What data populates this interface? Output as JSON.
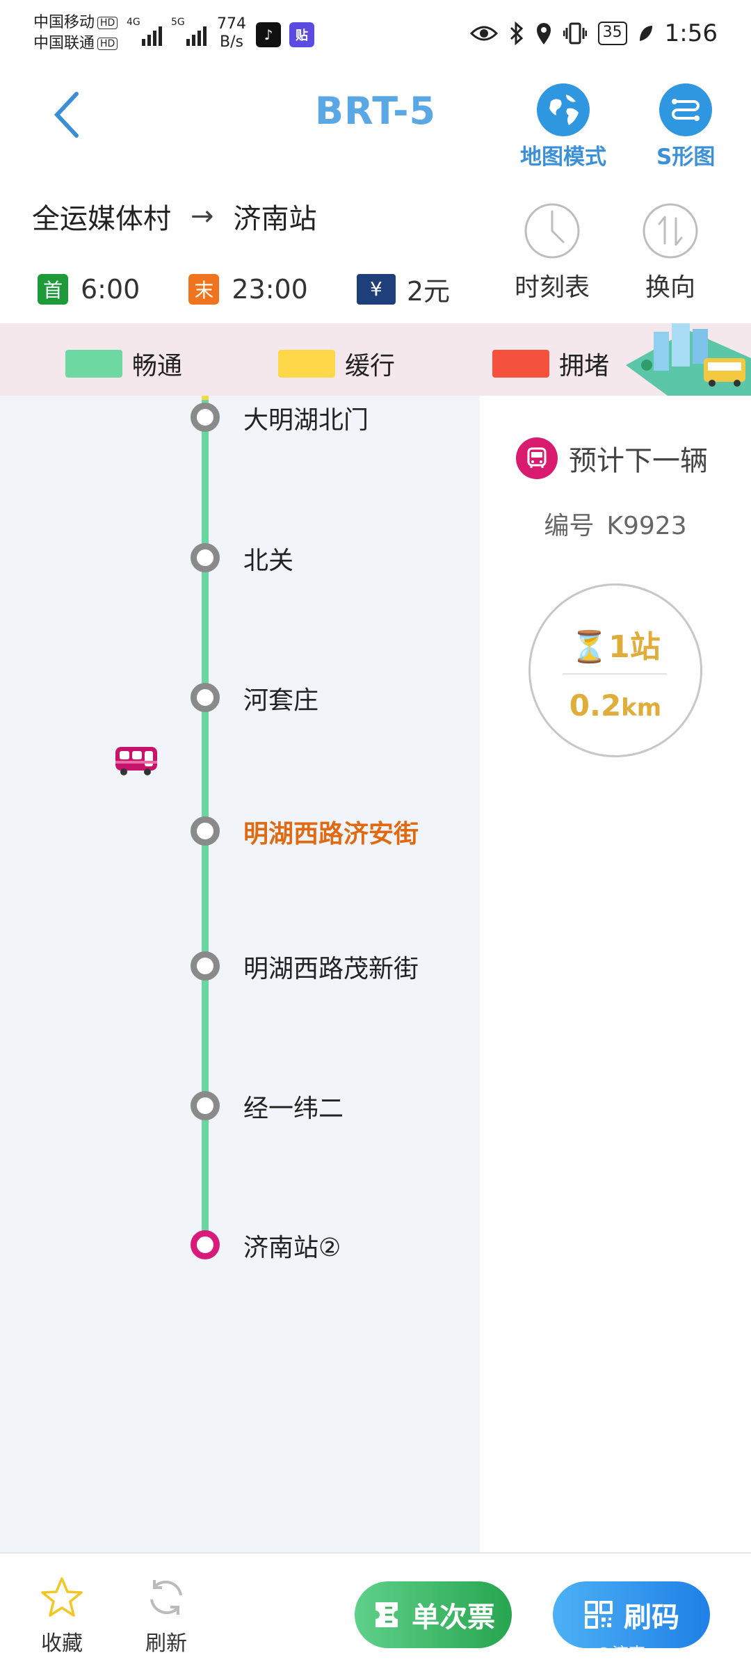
{
  "status_bar": {
    "carrier1": "中国移动",
    "carrier2": "中国联通",
    "hd": "HD",
    "net1": "4G",
    "net2": "5G",
    "speed_value": "774",
    "speed_unit": "B/s",
    "app_badge": "贴",
    "battery": "35",
    "time": "1:56"
  },
  "header": {
    "title": "BRT-5",
    "map_mode_label": "地图模式",
    "s_map_label": "S形图"
  },
  "route": {
    "from": "全运媒体村",
    "arrow": "→",
    "to": "济南站",
    "first_tag": "首",
    "first_time": "6:00",
    "last_tag": "末",
    "last_time": "23:00",
    "fare_tag": "¥",
    "fare": "2元",
    "timetable_label": "时刻表",
    "reverse_label": "换向",
    "colors": {
      "first": "#1e9a3a",
      "last": "#f0731e",
      "fare": "#1f3f7a"
    }
  },
  "legend": {
    "items": [
      {
        "label": "畅通",
        "color": "#6dd8a2"
      },
      {
        "label": "缓行",
        "color": "#ffd84a"
      },
      {
        "label": "拥堵",
        "color": "#f4523c"
      }
    ]
  },
  "stops": [
    {
      "name": "大明湖北门",
      "current": false
    },
    {
      "name": "北关",
      "current": false
    },
    {
      "name": "河套庄",
      "current": false
    },
    {
      "name": "明湖西路济安街",
      "current": true
    },
    {
      "name": "明湖西路茂新街",
      "current": false
    },
    {
      "name": "经一纬二",
      "current": false
    },
    {
      "name": "济南站②",
      "current": false
    }
  ],
  "next_bus": {
    "title": "预计下一辆",
    "number_label": "编号",
    "number": "K9923",
    "stops_away": "1站",
    "distance": "0.2",
    "distance_unit": "km"
  },
  "bottom": {
    "favorite_label": "收藏",
    "refresh_label": "刷新",
    "single_ticket_label": "单次票",
    "scan_code_label": "刷码",
    "watermark": "@济南…"
  }
}
